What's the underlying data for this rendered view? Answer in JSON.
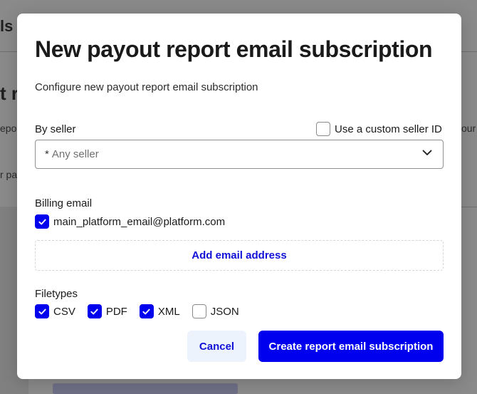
{
  "background": {
    "topbar_fragment": "ls",
    "heading_fragment": "t r",
    "left_fragment_1": "epo",
    "left_fragment_2": "r pa",
    "right_fragment": "our"
  },
  "modal": {
    "title": "New payout report email subscription",
    "subtitle": "Configure new payout report email subscription",
    "seller": {
      "label": "By seller",
      "custom_id_label": "Use a custom seller ID",
      "custom_id_checked": false,
      "required_marker": "*",
      "select_value": "Any seller"
    },
    "billing": {
      "label": "Billing email",
      "emails": [
        {
          "address": "main_platform_email@platform.com",
          "checked": true
        }
      ],
      "add_label": "Add email address"
    },
    "filetypes": {
      "label": "Filetypes",
      "options": [
        {
          "name": "CSV",
          "checked": true
        },
        {
          "name": "PDF",
          "checked": true
        },
        {
          "name": "XML",
          "checked": true
        },
        {
          "name": "JSON",
          "checked": false
        }
      ]
    },
    "actions": {
      "cancel_label": "Cancel",
      "create_label": "Create report email subscription"
    }
  },
  "colors": {
    "accent": "#0000ee",
    "link": "#1010d8",
    "cancel_bg": "#ecf3fd",
    "overlay": "#8a8a8a"
  }
}
